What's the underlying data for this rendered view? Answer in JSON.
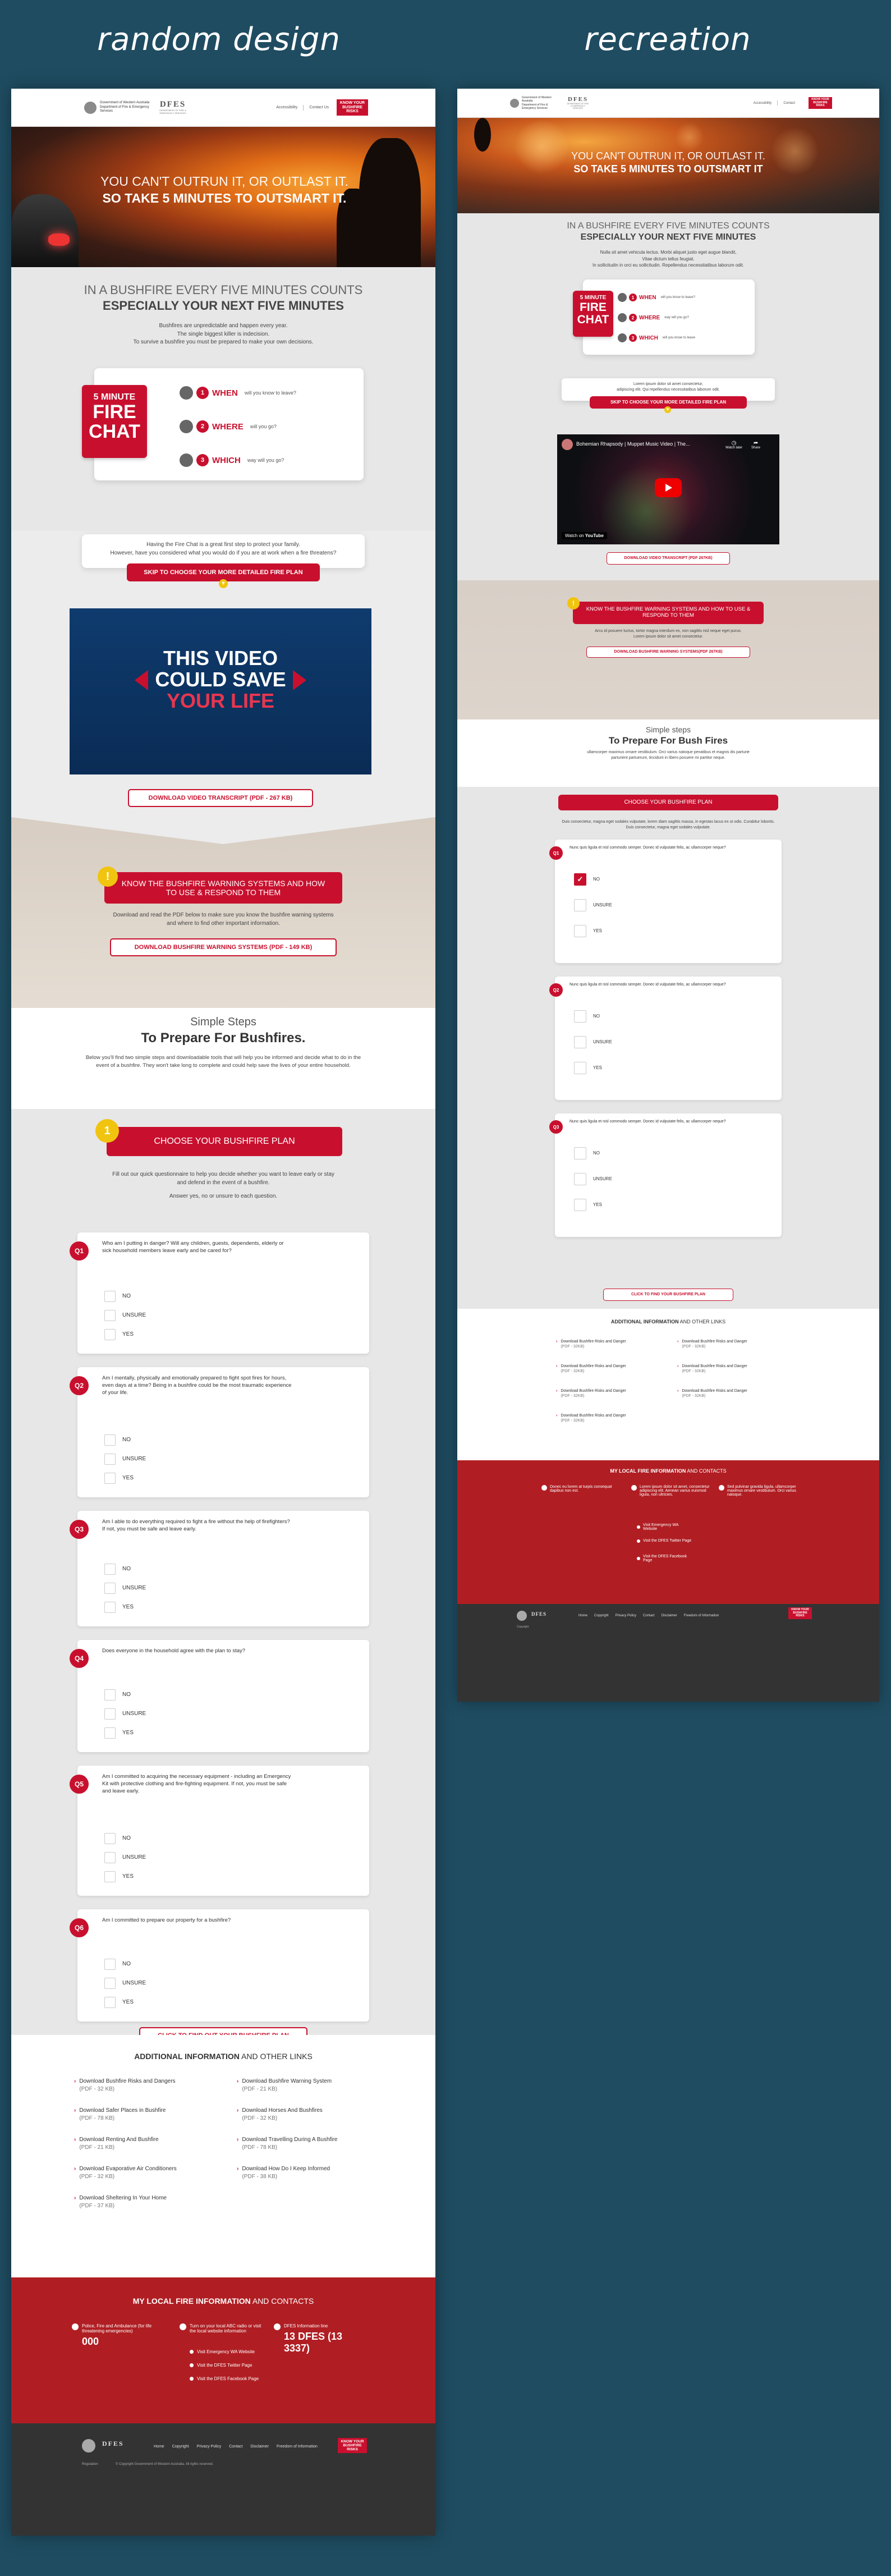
{
  "captions": {
    "left": "random design",
    "right": "recreation"
  },
  "header": {
    "govt_line1": "Government of Western Australia",
    "govt_line2": "Department of Fire & Emergency Services",
    "dfes": "DFES",
    "dfes_sub": "DEPARTMENT OF FIRE & EMERGENCY SERVICES",
    "nav": [
      "Accessibility",
      "Contact Us"
    ],
    "nav_right": [
      "Accessibility",
      "Contact"
    ],
    "badge": [
      "KNOW YOUR",
      "BUSHFIRE",
      "RISKS",
      "IN YOUR",
      "SAFETY"
    ]
  },
  "hero": {
    "line1": "YOU CAN'T OUTRUN IT, OR OUTLAST IT.",
    "line2": "SO TAKE 5 MINUTES TO OUTSMART IT.",
    "line2_right": "SO TAKE 5 MINUTES TO OUTSMART IT"
  },
  "intro": {
    "heading1": "IN A BUSHFIRE EVERY FIVE MINUTES COUNTS",
    "heading2": "ESPECIALLY YOUR NEXT FIVE MINUTES",
    "body_left": [
      "Bushfires are unpredictable and happen every year.",
      "The single biggest killer is indecision.",
      "To survive a bushfire you must be prepared to make your own decisions."
    ],
    "body_right": [
      "Nulla sit amet vehicula lectus. Morbi aliquet justo eget augue blandit,",
      "Vitae dictum tellus feugiat.",
      "In sollicitudin in orci eu sollicitudin. Repellendus necessitatibus laborum odit."
    ]
  },
  "fire_chat": {
    "badge": [
      "5 MINUTE",
      "FIRE",
      "CHAT"
    ],
    "left": [
      {
        "n": "1",
        "word": "WHEN",
        "rest": "will you know to leave?"
      },
      {
        "n": "2",
        "word": "WHERE",
        "rest": "will you go?"
      },
      {
        "n": "3",
        "word": "WHICH",
        "rest": "way will you go?"
      }
    ],
    "right": [
      {
        "n": "1",
        "word": "WHEN",
        "rest": "will you know to leave?"
      },
      {
        "n": "2",
        "word": "WHERE",
        "rest": "way will you go?"
      },
      {
        "n": "3",
        "word": "WHICH",
        "rest": "will you know to leave"
      }
    ]
  },
  "skip": {
    "left_text": [
      "Having the Fire Chat is a great first step to protect your family.",
      "However, have you considered what you would do if you are at work when a fire threatens?"
    ],
    "right_text": [
      "Lorem ipsum dolor sit amet consectetur,",
      "adipiscing elit. Qui repellendus necessitatibus laborum odit."
    ],
    "button": "SKIP TO CHOOSE YOUR MORE DETAILED FIRE PLAN"
  },
  "video": {
    "left_line1": "THIS VIDEO",
    "left_line2": "COULD SAVE",
    "left_line3": "YOUR LIFE",
    "right_title": "Bohemian Rhapsody | Muppet Music Video | The...",
    "right_watch_later": "Watch later",
    "right_share": "Share",
    "right_watch_on": "Watch on",
    "right_youtube": "YouTube",
    "transcript_left": "DOWNLOAD VIDEO TRANSCRIPT (PDF - 267 KB)",
    "transcript_right": "DOWNLOAD VIDEO TRANSCRIPT (PDF 267KB)"
  },
  "warning": {
    "badge": "!",
    "title": "KNOW THE BUSHFIRE WARNING SYSTEMS AND HOW TO USE & RESPOND TO THEM",
    "left_text": [
      "Download and read the PDF below to make sure you know the bushfire warning systems",
      "and where to find other important information."
    ],
    "right_text": [
      "Arcu id posuere luctus, tortor magna interdum ex, non sagittis nisl neque eget purus.",
      "Lorem ipsum dolor sit amet consectetur."
    ],
    "download_left": "DOWNLOAD BUSHFIRE WARNING SYSTEMS (PDF - 149 KB)",
    "download_right": "DOWNLOAD BUSHFIRE WARNING SYSTEMS(PDF 267KB)"
  },
  "simple": {
    "line1_left": "Simple Steps",
    "line2_left": "To Prepare For Bushfires.",
    "line1_right": "Simple steps",
    "line2_right": "To Prepare For Bush Fires",
    "body_left": [
      "Below you'll find two simple steps and downloadable tools that will help you be informed and decide what to do in the",
      "event of a bushfire. They won't take long to complete and could help save the lives of your entire household."
    ],
    "body_right": [
      "ullamcorper maximus ornare vestibulum. Orci varius natoque penatibus et magnis dis parturie",
      "parturient partuerunt, tincidunt in libero posuere mi partitor neque."
    ]
  },
  "plan": {
    "step": "1",
    "title": "CHOOSE YOUR BUSHFIRE PLAN",
    "left_text": [
      "Fill out our quick questionnaire to help you decide whether you want to leave early or stay",
      "and defend in the event of a bushfire.",
      "",
      "Answer yes, no or unsure to each question."
    ],
    "right_text": [
      "Duis consectetur, magna eget sodales vulputate, lorem diam sagittis massa, in egestas lacus ex ut odio. Curabitur lobortis.",
      "Duis consectetur, magna eget sodales vulputate."
    ],
    "options": [
      "NO",
      "UNSURE",
      "YES"
    ],
    "questions_left": [
      {
        "n": "Q1",
        "text": "Who am I putting in danger? Will any children, guests, dependents, elderly or sick household members leave early and be cared for?"
      },
      {
        "n": "Q2",
        "text": "Am I mentally, physically and emotionally prepared to fight spot fires for hours, even days at a time? Being in a bushfire could be the most traumatic experience of your life."
      },
      {
        "n": "Q3",
        "text": "Am I able to do everything required to fight a fire without the help of firefighters? If not, you must be safe and leave early."
      },
      {
        "n": "Q4",
        "text": "Does everyone in the household agree with the plan to stay?"
      },
      {
        "n": "Q5",
        "text": "Am I committed to acquiring the necessary equipment - including an Emergency Kit with protective clothing and fire-fighting equipment. If not, you must be safe and leave early."
      },
      {
        "n": "Q6",
        "text": "Am I committed to prepare our property for a bushfire?"
      }
    ],
    "questions_right": [
      {
        "n": "Q1",
        "text": "Nunc quis ligula et nisl commodo semper. Donec id vulputate felis, ac ullamcorper neque?"
      },
      {
        "n": "Q2",
        "text": "Nunc quis ligula et nisl commodo semper. Donec id vulputate felis, ac ullamcorper neque?"
      },
      {
        "n": "Q3",
        "text": "Nunc quis ligula et nisl commodo semper. Donec id vulputate felis, ac ullamcorper neque?"
      }
    ],
    "right_q1_selected": "NO",
    "find_left": "CLICK TO FIND OUT YOUR BUSHFIRE PLAN",
    "find_right": "CLICK TO FIND YOUR BUSHFIRE PLAN"
  },
  "additional": {
    "title_bold": "ADDITIONAL INFORMATION",
    "title_rest": " AND OTHER LINKS",
    "left": [
      {
        "t": "Download Bushfire Risks and Dangers",
        "s": "(PDF - 32 KB)"
      },
      {
        "t": "Download Bushfire Warning System",
        "s": "(PDF - 21 KB)"
      },
      {
        "t": "Download Safer Places in Bushfire",
        "s": "(PDF - 78 KB)"
      },
      {
        "t": "Download Horses And Bushfires",
        "s": "(PDF - 32 KB)"
      },
      {
        "t": "Download Renting And Bushfire",
        "s": "(PDF - 21 KB)"
      },
      {
        "t": "Download Travelling During A Bushfire",
        "s": "(PDF - 78 KB)"
      },
      {
        "t": "Download Evaporative Air Conditioners",
        "s": "(PDF - 32 KB)"
      },
      {
        "t": "Download How Do I Keep Informed",
        "s": "(PDF - 38 KB)"
      },
      {
        "t": "Download Sheltering In Your Home",
        "s": "(PDF - 37 KB)"
      }
    ],
    "right": [
      {
        "t": "Download Bushfire Risks and Danger",
        "s": "(PDF - 32KB)"
      },
      {
        "t": "Download Bushfire Risks and Danger",
        "s": "(PDF - 32KB)"
      },
      {
        "t": "Download Bushfire Risks and Danger",
        "s": "(PDF - 32KB)"
      },
      {
        "t": "Download Bushfire Risks and Danger",
        "s": "(PDF - 32KB)"
      },
      {
        "t": "Download Bushfire Risks and Danger",
        "s": "(PDF - 32KB)"
      },
      {
        "t": "Download Bushfire Risks and Danger",
        "s": "(PDF - 32KB)"
      },
      {
        "t": "Download Bushfire Risks and Danger",
        "s": "(PDF - 32KB)"
      }
    ]
  },
  "local": {
    "title_bold": "MY LOCAL FIRE INFORMATION",
    "title_rest": " AND CONTACTS",
    "left_col1": "Police, Fire and Ambulance (for life threatening emergencies)",
    "left_col1_big": "000",
    "left_col2": "Turn on your local ABC radio or visit the local website information",
    "left_col3": "DFES Information line",
    "left_col3_big": "13 DFES (13 3337)",
    "left_links": [
      "Visit Emergency WA Website",
      "Visit the DFES Twitter Page",
      "Visit the DFES Facebook Page"
    ],
    "right_col1": "Donec eu lorem at turpis consequat dapibus non est.",
    "right_col2": "Lorem ipsum dolor sit amet, consectetur adipiscing elit. Aenean varius euismod ligula, non ultricies.",
    "right_col3": "Sed pulvinar gravida ligula, ullamcorper maximus ornare vestibulum. Orci varius natoque.",
    "right_links": [
      "Visit Emergency WA Website",
      "Visit the DFES Twitter Page",
      "Visit the DFES Facebook Page"
    ]
  },
  "footer": {
    "links": [
      "Home",
      "Copyright",
      "Privacy Policy",
      "Contact",
      "Disclaimer",
      "Freedom of Information"
    ],
    "copyright_left": "© Copyright Government of Western Australia. All rights reserved.",
    "left_small": "Regulation",
    "right_small": "Copyright"
  }
}
